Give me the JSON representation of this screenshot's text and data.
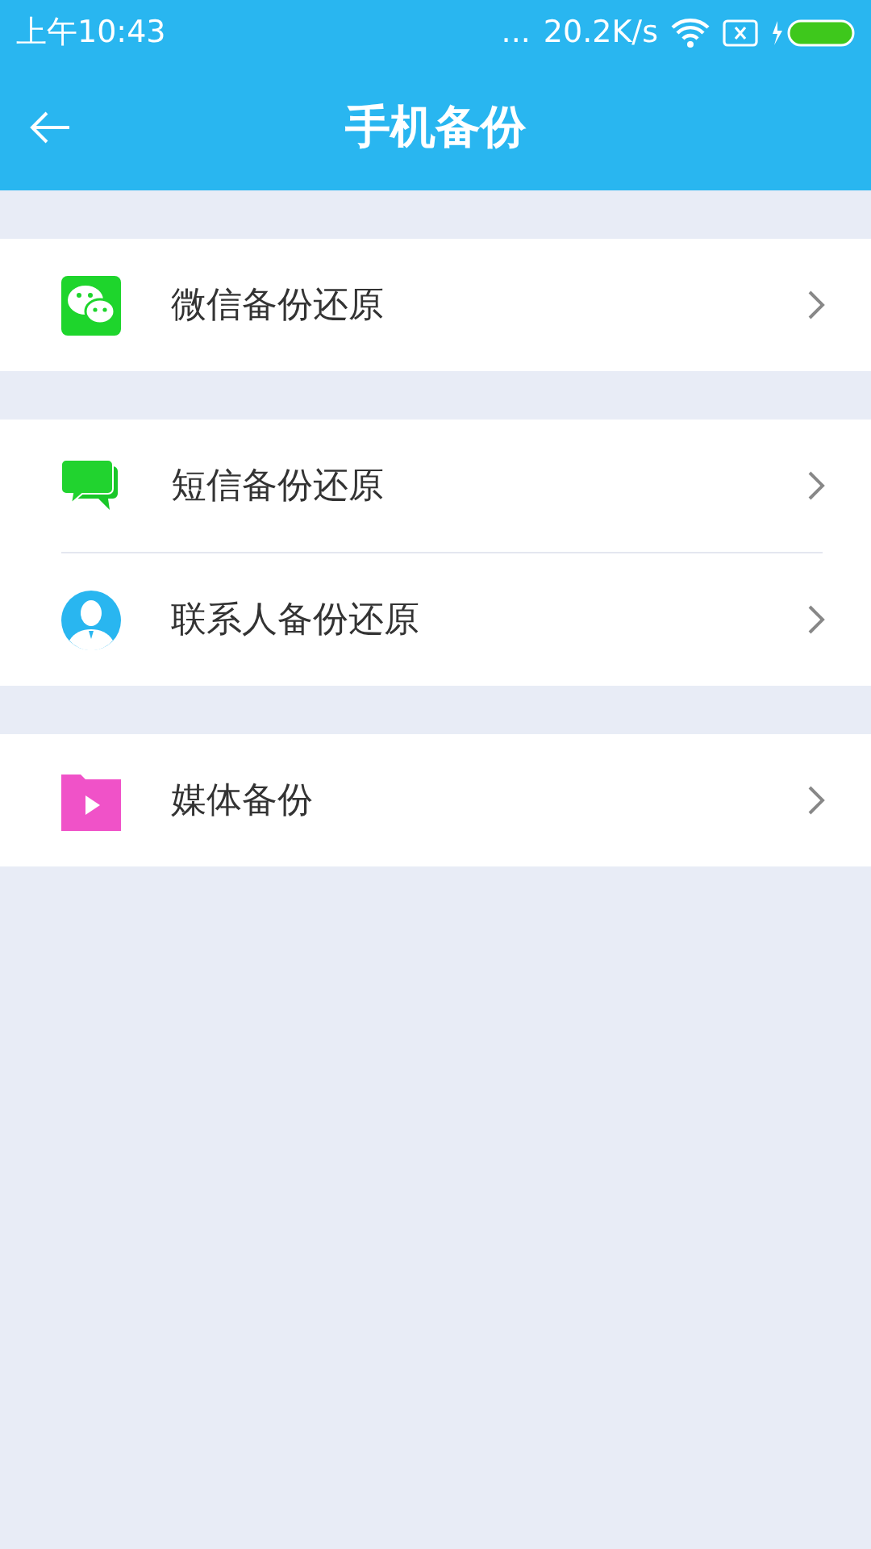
{
  "status_bar": {
    "time": "上午10:43",
    "dots": "...",
    "speed": "20.2K/s"
  },
  "app_bar": {
    "title": "手机备份"
  },
  "groups": [
    {
      "items": [
        {
          "kind": "wechat",
          "label": "微信备份还原"
        }
      ]
    },
    {
      "items": [
        {
          "kind": "sms",
          "label": "短信备份还原"
        },
        {
          "kind": "contacts",
          "label": "联系人备份还原"
        }
      ]
    },
    {
      "items": [
        {
          "kind": "media",
          "label": "媒体备份"
        }
      ]
    }
  ]
}
